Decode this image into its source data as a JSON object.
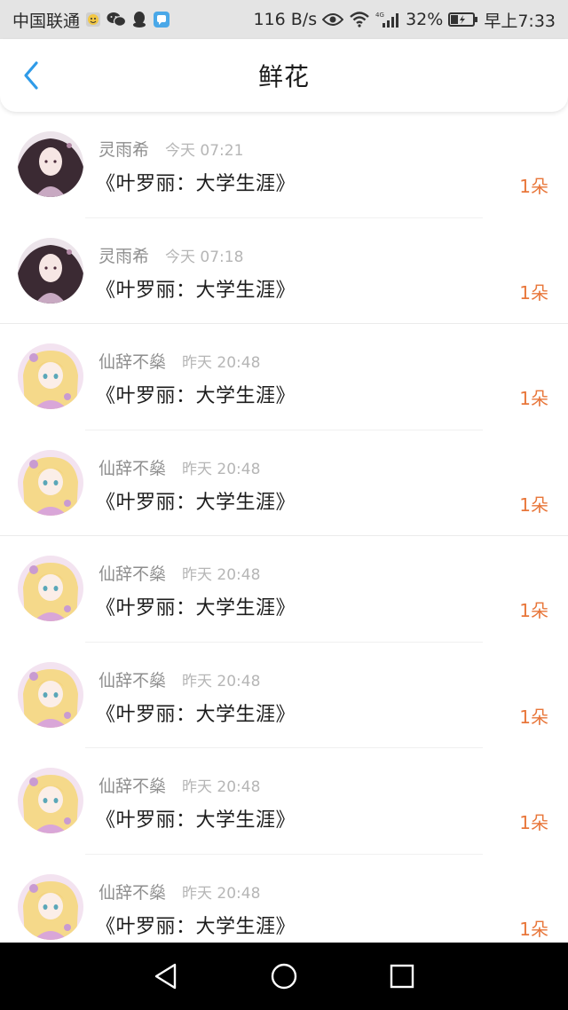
{
  "status_bar": {
    "carrier": "中国联通",
    "net_speed": "116 B/s",
    "battery": "32%",
    "time": "早上7:33",
    "icons": [
      "emoji-icon",
      "wechat-icon",
      "qq-icon",
      "app-icon",
      "eye-icon",
      "wifi-icon",
      "signal-4g-icon",
      "battery-charging-icon"
    ]
  },
  "header": {
    "title": "鲜花",
    "back_icon": "chevron-left-icon"
  },
  "gifts": [
    {
      "sender": "灵雨希",
      "time": "今天 07:21",
      "book": "《叶罗丽：大学生涯》",
      "count": "1朵",
      "avatar": "avatar-dark-hair"
    },
    {
      "sender": "灵雨希",
      "time": "今天 07:18",
      "book": "《叶罗丽：大学生涯》",
      "count": "1朵",
      "avatar": "avatar-dark-hair"
    },
    {
      "sender": "仙辞不燊",
      "time": "昨天 20:48",
      "book": "《叶罗丽：大学生涯》",
      "count": "1朵",
      "avatar": "avatar-blonde-doll"
    },
    {
      "sender": "仙辞不燊",
      "time": "昨天 20:48",
      "book": "《叶罗丽：大学生涯》",
      "count": "1朵",
      "avatar": "avatar-blonde-doll"
    },
    {
      "sender": "仙辞不燊",
      "time": "昨天 20:48",
      "book": "《叶罗丽：大学生涯》",
      "count": "1朵",
      "avatar": "avatar-blonde-doll"
    },
    {
      "sender": "仙辞不燊",
      "time": "昨天 20:48",
      "book": "《叶罗丽：大学生涯》",
      "count": "1朵",
      "avatar": "avatar-blonde-doll"
    },
    {
      "sender": "仙辞不燊",
      "time": "昨天 20:48",
      "book": "《叶罗丽：大学生涯》",
      "count": "1朵",
      "avatar": "avatar-blonde-doll"
    },
    {
      "sender": "仙辞不燊",
      "time": "昨天 20:48",
      "book": "《叶罗丽：大学生涯》",
      "count": "1朵",
      "avatar": "avatar-blonde-doll"
    }
  ],
  "nav_bar": {
    "icons": [
      "back-triangle-icon",
      "home-circle-icon",
      "recents-square-icon"
    ]
  },
  "colors": {
    "accent": "#2f9be8",
    "count": "#e8763a",
    "name": "#8e8e8e",
    "time": "#b6b6b6"
  }
}
